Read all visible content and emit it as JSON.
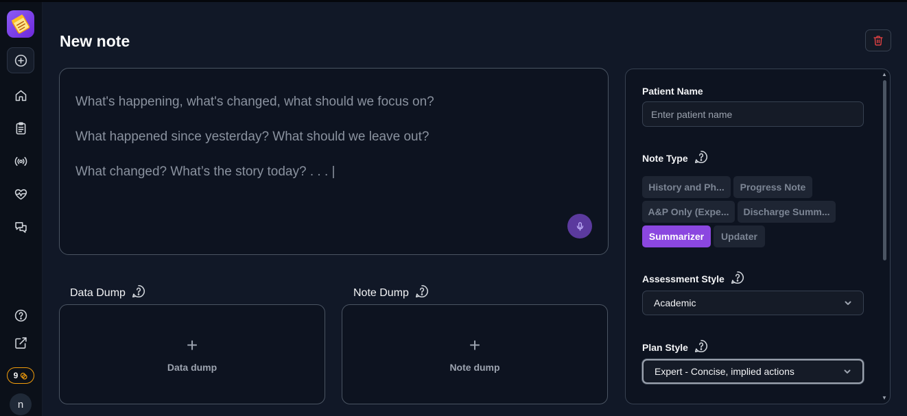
{
  "page": {
    "title": "New note"
  },
  "editor": {
    "lines": [
      "What's happening, what's changed, what should we focus on?",
      "What happened since yesterday? What should we leave out?",
      "What changed? What’s the story today? . . . |"
    ]
  },
  "dumps": {
    "data": {
      "label": "Data Dump",
      "box_label": "Data dump",
      "plus": "+"
    },
    "note": {
      "label": "Note Dump",
      "box_label": "Note dump",
      "plus": "+"
    }
  },
  "panel": {
    "patient_name": {
      "label": "Patient Name",
      "placeholder": "Enter patient name",
      "value": ""
    },
    "note_type": {
      "label": "Note Type",
      "options": [
        "History and Ph...",
        "Progress Note",
        "A&P Only (Expe...",
        "Discharge Summ...",
        "Summarizer",
        "Updater"
      ],
      "selected": "Summarizer"
    },
    "assessment_style": {
      "label": "Assessment Style",
      "value": "Academic"
    },
    "plan_style": {
      "label": "Plan Style",
      "value": "Expert - Concise, implied actions"
    }
  },
  "sidebar": {
    "credits": "9",
    "avatar_initial": "n"
  },
  "icons": {
    "logo": "notepad-logo-icon",
    "new": "plus-circle-icon",
    "home": "home-icon",
    "notes": "clipboard-icon",
    "live": "broadcast-icon",
    "health": "heart-pulse-icon",
    "chat": "chat-bubbles-icon",
    "help": "help-circle-icon",
    "external": "external-link-icon",
    "trash": "trash-icon",
    "mic": "microphone-icon",
    "chevron": "chevron-down-icon"
  },
  "colors": {
    "accent": "#8b47e0",
    "delete": "#ef4444",
    "credits_border": "#f59e0b"
  }
}
